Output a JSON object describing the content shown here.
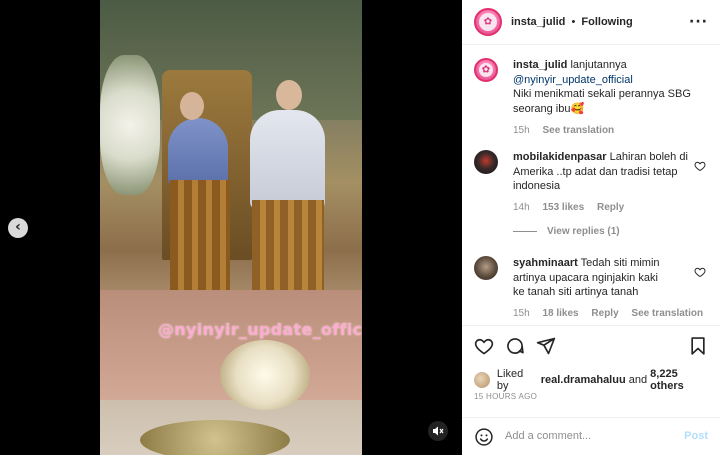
{
  "header": {
    "username": "insta_julid",
    "separator": "•",
    "follow_status": "Following",
    "more_icon": "more-horizontal-icon"
  },
  "media": {
    "watermark": "@nyinyir_update_official",
    "prev_icon": "chevron-left-icon",
    "mute_icon": "speaker-muted-icon"
  },
  "caption": {
    "username": "insta_julid",
    "text_1": "lanjutannya",
    "mention": "@nyinyir_update_official",
    "text_2": "Niki menikmati sekali perannya SBG seorang ibu🥰",
    "time": "15h",
    "see_translation": "See translation"
  },
  "comments": [
    {
      "username": "mobilakidenpasar",
      "text": "Lahiran boleh di Amerika ..tp adat dan tradisi tetap indonesia",
      "time": "14h",
      "likes": "153 likes",
      "reply": "Reply",
      "view_replies": "View replies (1)"
    },
    {
      "username": "syahminaart",
      "text": "Tedah siti mimin artinya upacara nginjakin kaki ke tanah siti artinya tanah",
      "time": "15h",
      "likes": "18 likes",
      "reply": "Reply",
      "see_translation": "See translation"
    }
  ],
  "actions": {
    "like_icon": "heart-icon",
    "comment_icon": "comment-icon",
    "share_icon": "send-icon",
    "save_icon": "bookmark-icon"
  },
  "likes": {
    "prefix": "Liked by",
    "user": "real.dramahaluu",
    "conj": "and",
    "others": "8,225 others"
  },
  "timestamp": "15 HOURS AGO",
  "add_comment": {
    "placeholder": "Add a comment...",
    "post_label": "Post",
    "emoji_icon": "smiley-icon"
  },
  "colors": {
    "link": "#00376b",
    "muted": "#8e8e8e",
    "post_disabled": "#b2dffc",
    "avatar_ring": "#e1306c"
  }
}
